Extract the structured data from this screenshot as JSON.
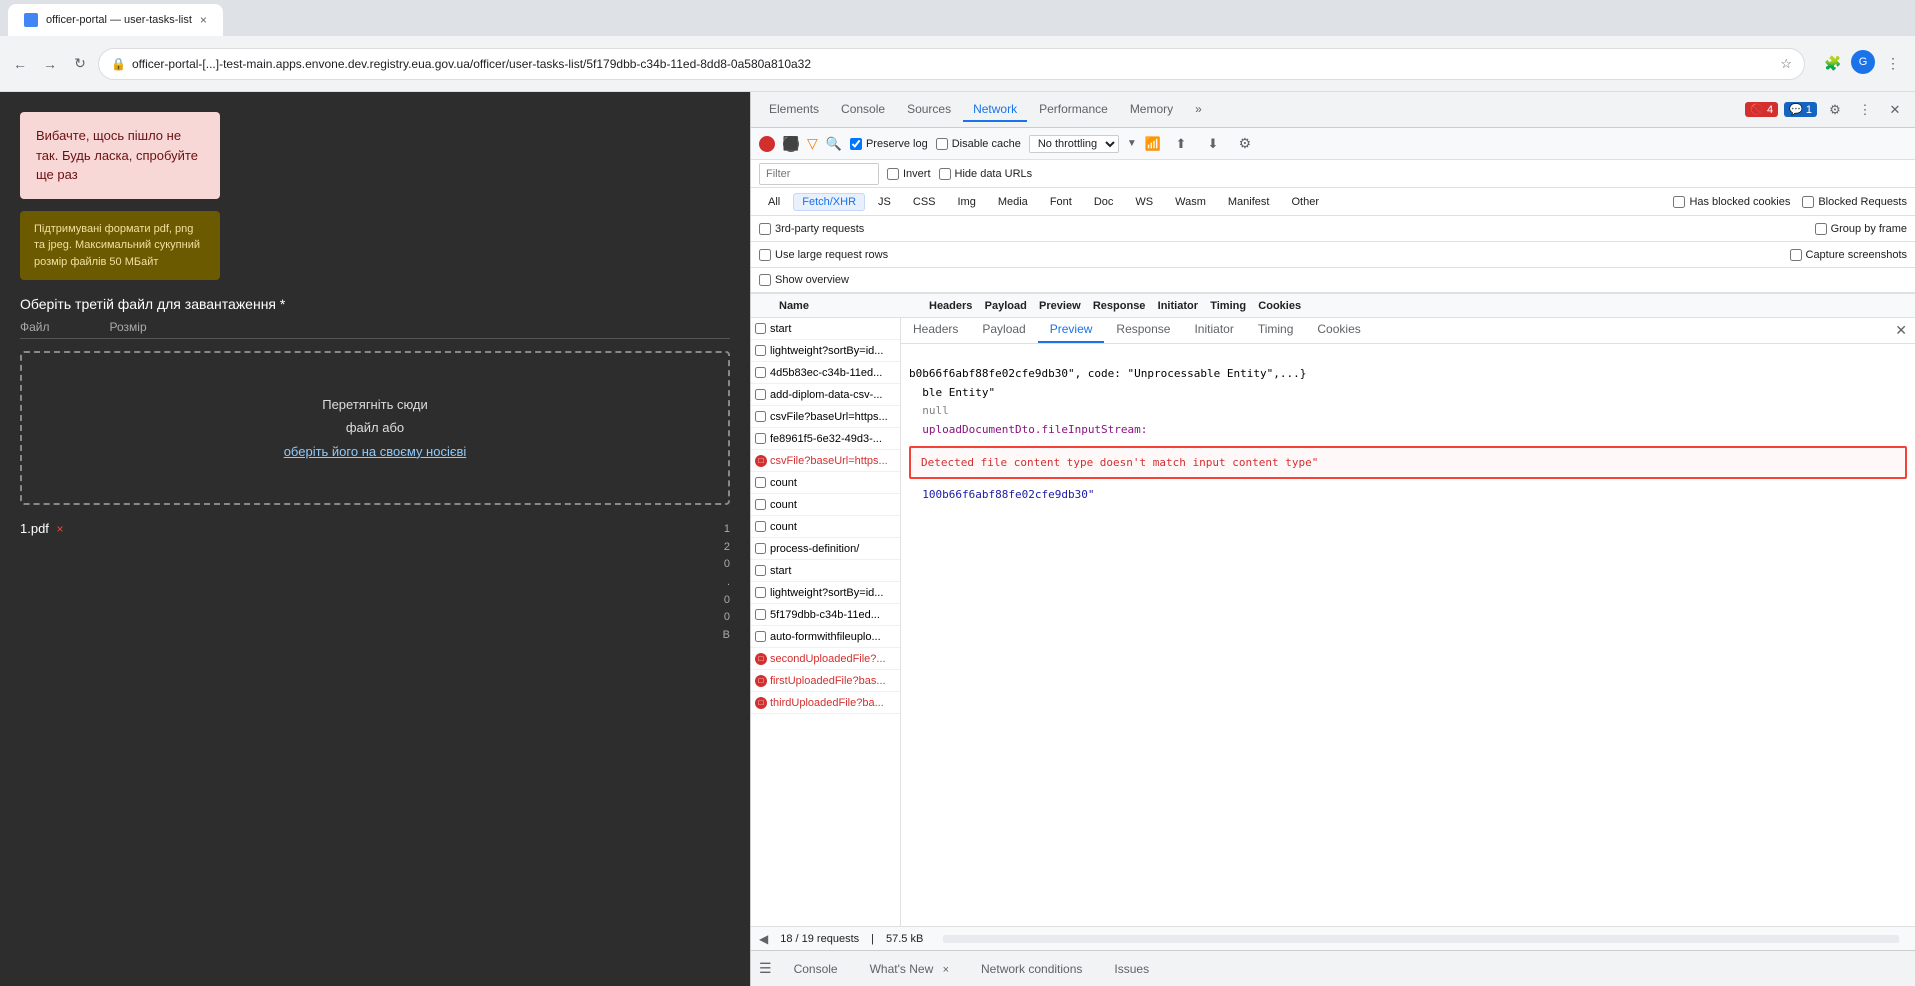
{
  "browser": {
    "url": "officer-portal-[...]-test-main.apps.envone.dev.registry.eua.gov.ua/officer/user-tasks-list/5f179dbb-c34b-11ed-8dd8-0a580a810a32",
    "back_label": "←",
    "forward_label": "→",
    "reload_label": "↻",
    "more_label": "⋮"
  },
  "error_box": {
    "text": "Вибачте, щось пішло не так. Будь ласка, спробуйте ще раз"
  },
  "info_box": {
    "text": "Підтримувані формати pdf, png та jpeg. Максимальний сукупний розмір файлів 50 МБайт"
  },
  "upload_section": {
    "title": "Оберіть третій файл для завантаження *",
    "file_label": "Файл",
    "size_label": "Розмір",
    "drop_text_line1": "Перетягніть сюди",
    "drop_text_line2": "файл або",
    "drop_link": "оберіть його на своєму носієві",
    "uploaded_file": "1.pdf ×",
    "file_size_lines": [
      "1",
      "2",
      "0",
      ".",
      "0",
      "0",
      "В"
    ]
  },
  "devtools": {
    "tabs": [
      "Elements",
      "Console",
      "Sources",
      "Network",
      "Performance",
      "Memory",
      "»"
    ],
    "active_tab": "Network",
    "errors_count": "4",
    "warnings_count": "1",
    "network_toolbar": {
      "preserve_log_label": "Preserve log",
      "disable_cache_label": "Disable cache",
      "no_throttling_label": "No throttling",
      "filter_placeholder": "Filter"
    },
    "filter_types": [
      "All",
      "Fetch/XHR",
      "JS",
      "CSS",
      "Img",
      "Media",
      "Font",
      "Doc",
      "WS",
      "Wasm",
      "Manifest",
      "Other"
    ],
    "active_filter": "Fetch/XHR",
    "checkboxes": {
      "invert": "Invert",
      "hide_data_urls": "Hide data URLs",
      "third_party": "3rd-party requests",
      "use_large_rows": "Use large request rows",
      "show_overview": "Show overview",
      "group_by_frame": "Group by frame",
      "capture_screenshots": "Capture screenshots",
      "has_blocked_cookies": "Has blocked cookies",
      "blocked_requests": "Blocked Requests"
    },
    "network_rows": [
      {
        "name": "start",
        "error": false,
        "id": "r1"
      },
      {
        "name": "lightweight?sortBy=id...",
        "error": false,
        "id": "r2"
      },
      {
        "name": "4d5b83ec-c34b-11ed...",
        "error": false,
        "id": "r3"
      },
      {
        "name": "add-diplom-data-csv-...",
        "error": false,
        "id": "r4"
      },
      {
        "name": "csvFile?baseUrl=https...",
        "error": false,
        "id": "r5"
      },
      {
        "name": "fe8961f5-6e32-49d3-...",
        "error": false,
        "id": "r6"
      },
      {
        "name": "csvFile?baseUrl=https...",
        "error": true,
        "id": "r7"
      },
      {
        "name": "count",
        "error": false,
        "id": "r8"
      },
      {
        "name": "count",
        "error": false,
        "id": "r9"
      },
      {
        "name": "count",
        "error": false,
        "id": "r10"
      },
      {
        "name": "process-definition/",
        "error": false,
        "id": "r11"
      },
      {
        "name": "start",
        "error": false,
        "id": "r12"
      },
      {
        "name": "lightweight?sortBy=id...",
        "error": false,
        "id": "r13"
      },
      {
        "name": "5f179dbb-c34b-11ed...",
        "error": false,
        "id": "r14"
      },
      {
        "name": "auto-formwithfileuplo...",
        "error": false,
        "id": "r15"
      },
      {
        "name": "secondUploadedFile?...",
        "error": true,
        "id": "r16"
      },
      {
        "name": "firstUploadedFile?bas...",
        "error": true,
        "id": "r17"
      },
      {
        "name": "thirdUploadedFile?ba...",
        "error": true,
        "id": "r18"
      }
    ],
    "preview": {
      "response_text_1": "b0b66f6abf88fe02cfe9db30\", code: \"Unprocessable Entity\",...}",
      "response_text_2": "ble Entity\"",
      "response_text_3": "null",
      "key_label": "uploadDocumentDto.fileInputStream:",
      "error_value": "Detected file content type doesn't match input content type\"",
      "response_text_4": "100b66f6abf88fe02cfe9db30\""
    },
    "preview_tabs": [
      "Headers",
      "Payload",
      "Preview",
      "Response",
      "Initiator",
      "Timing",
      "Cookies"
    ],
    "active_preview_tab": "Preview",
    "status": {
      "requests": "18 / 19 requests",
      "size": "57.5 kB"
    },
    "bottom_tabs": [
      "Console",
      "What's New ×",
      "Network conditions",
      "Issues"
    ]
  }
}
